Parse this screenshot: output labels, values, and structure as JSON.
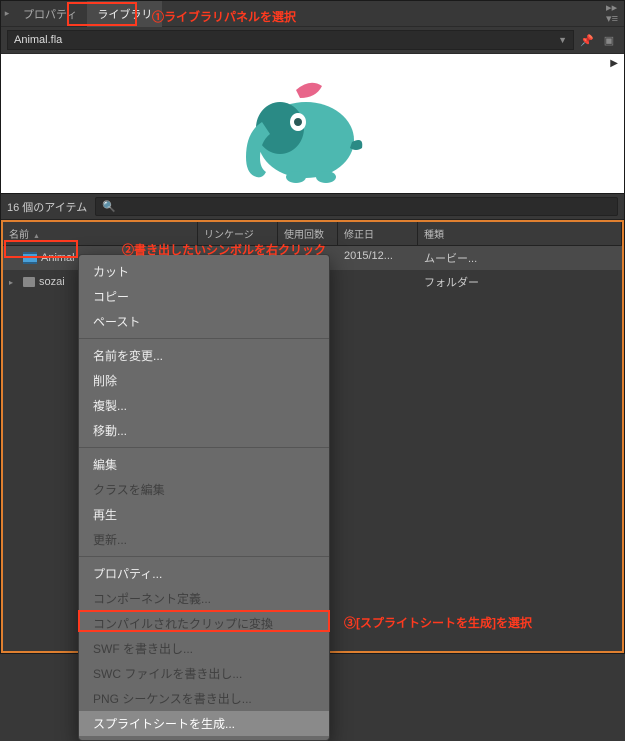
{
  "panel": {
    "tab_property": "プロパティ",
    "tab_library": "ライブラリ"
  },
  "document": "Animal.fla",
  "item_count": "16 個のアイテム",
  "search_placeholder": "",
  "columns": {
    "name": "名前",
    "linkage": "リンケージ",
    "use": "使用回数",
    "date": "修正日",
    "type": "種類"
  },
  "rows": [
    {
      "name": "Animal",
      "date": "2015/12...",
      "type": "ムービー..."
    },
    {
      "name": "sozai",
      "date": "",
      "type": "フォルダー"
    }
  ],
  "context_menu": {
    "cut": "カット",
    "copy": "コピー",
    "paste": "ペースト",
    "rename": "名前を変更...",
    "delete": "削除",
    "duplicate": "複製...",
    "move": "移動...",
    "edit": "編集",
    "edit_class": "クラスを編集",
    "play": "再生",
    "update": "更新...",
    "properties": "プロパティ...",
    "component_def": "コンポーネント定義...",
    "compiled_clip": "コンパイルされたクリップに変換",
    "export_swf": "SWF を書き出し...",
    "export_swc": "SWC ファイルを書き出し...",
    "export_png_seq": "PNG シーケンスを書き出し...",
    "gen_spritesheet": "スプライトシートを生成..."
  },
  "annotations": {
    "a1": "①ライブラリパネルを選択",
    "a2": "②書き出したいシンボルを右クリック",
    "a3": "③[スプライトシートを生成]を選択"
  }
}
